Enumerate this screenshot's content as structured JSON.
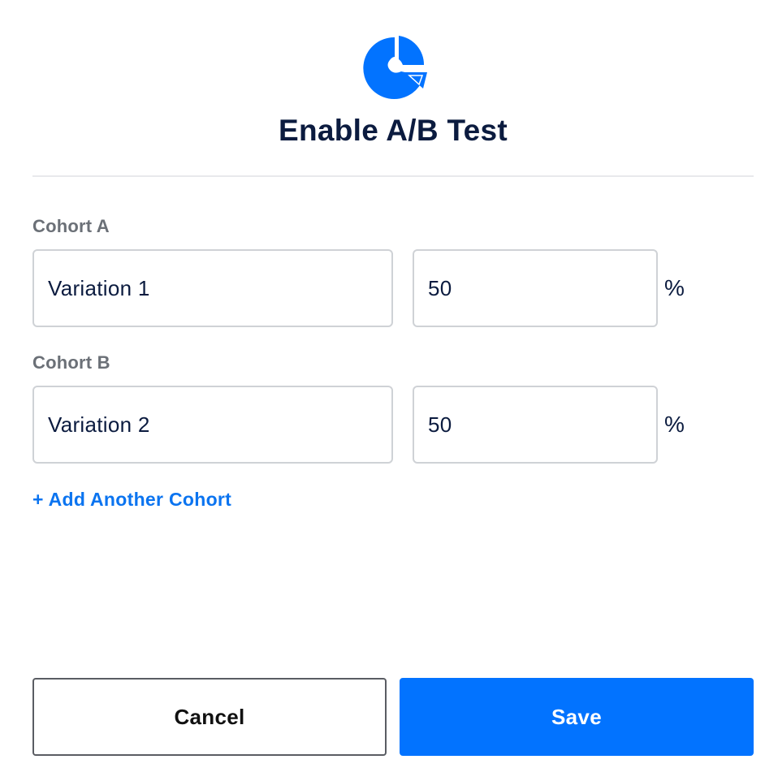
{
  "dialog": {
    "title": "Enable A/B Test",
    "logo_icon": "ab-test-pie-chart-icon",
    "accent_color": "#0273ff"
  },
  "cohorts": [
    {
      "label": "Cohort A",
      "name_value": "Variation 1",
      "percent_value": "50",
      "percent_symbol": "%"
    },
    {
      "label": "Cohort B",
      "name_value": "Variation 2",
      "percent_value": "50",
      "percent_symbol": "%"
    }
  ],
  "add_cohort_label": "+ Add Another Cohort",
  "buttons": {
    "cancel_label": "Cancel",
    "save_label": "Save"
  }
}
